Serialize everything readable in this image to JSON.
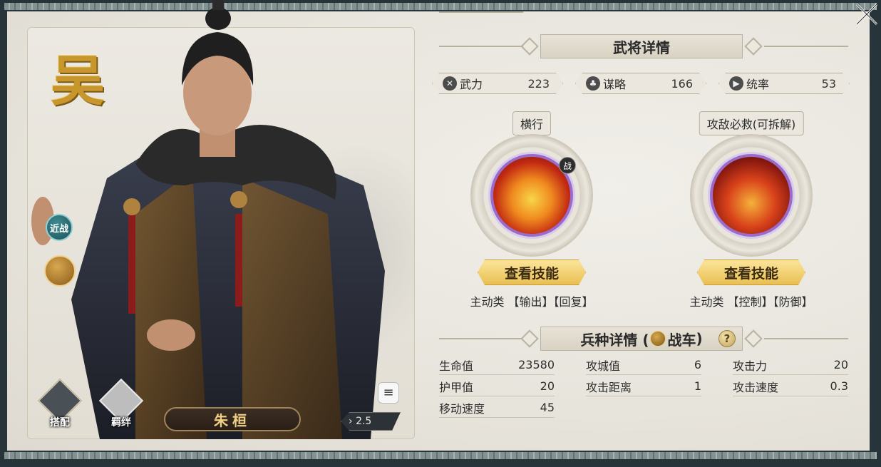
{
  "general": {
    "faction": "吴",
    "name": "朱桓",
    "cost": "2.5",
    "tags": {
      "melee": "近战"
    },
    "equip_label": "搭配",
    "bond_label": "羁绊"
  },
  "details": {
    "title": "武将详情",
    "stats": [
      {
        "icon": "force-icon",
        "label": "武力",
        "value": "223"
      },
      {
        "icon": "strategy-icon",
        "label": "谋略",
        "value": "166"
      },
      {
        "icon": "command-icon",
        "label": "统率",
        "value": "53"
      }
    ]
  },
  "skills": [
    {
      "name": "横行",
      "badge": "战",
      "button": "查看技能",
      "types": "主动类 【输出】【回复】"
    },
    {
      "name": "攻敌必救(可拆解)",
      "badge": "",
      "button": "查看技能",
      "types": "主动类 【控制】【防御】"
    }
  ],
  "troop": {
    "title_prefix": "兵种详情 (",
    "title_type": "战车",
    "title_suffix": ")",
    "help": "?",
    "stats": [
      {
        "label": "生命值",
        "value": "23580"
      },
      {
        "label": "攻城值",
        "value": "6"
      },
      {
        "label": "攻击力",
        "value": "20"
      },
      {
        "label": "护甲值",
        "value": "20"
      },
      {
        "label": "攻击距离",
        "value": "1"
      },
      {
        "label": "攻击速度",
        "value": "0.3"
      },
      {
        "label": "移动速度",
        "value": "45"
      }
    ]
  },
  "colors": {
    "accent_gold": "#e9bf52",
    "faction_gold": "#c7962d",
    "skill_frame_purple": "#9b6bc9"
  }
}
